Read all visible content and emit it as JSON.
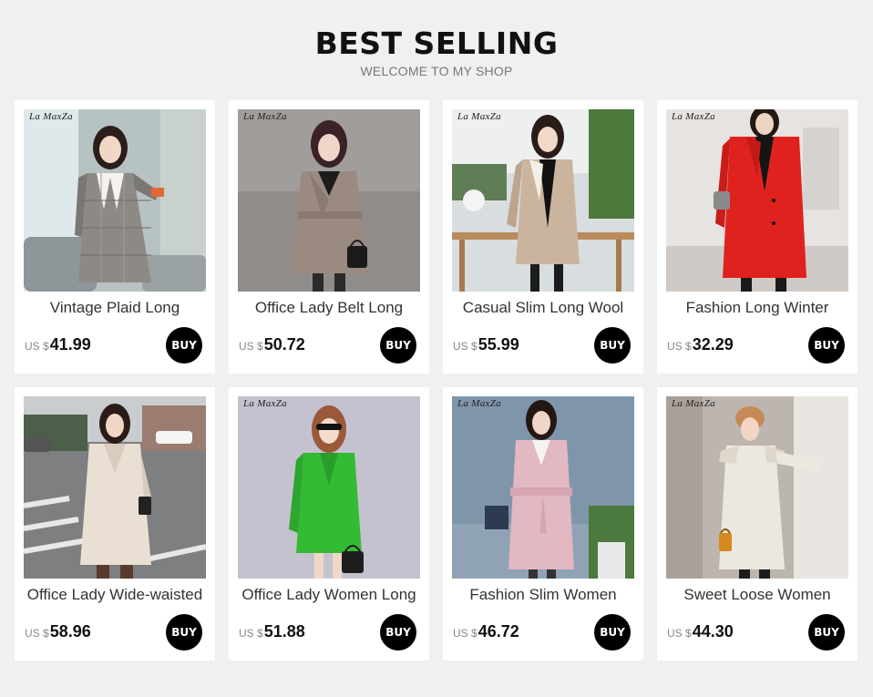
{
  "header": {
    "title": "BEST SELLING",
    "subtitle": "WELCOME TO MY SHOP"
  },
  "products": [
    {
      "name": "Vintage Plaid Long",
      "currency": "US $",
      "price": "41.99",
      "buy_label": "BUY",
      "brand": "La MaxZa",
      "image": "woman-in-gray-plaid-long-coat",
      "coat_color": "#8d8a86"
    },
    {
      "name": "Office Lady Belt Long",
      "currency": "US $",
      "price": "50.72",
      "buy_label": "BUY",
      "brand": "La MaxZa",
      "image": "woman-in-taupe-belted-coat",
      "coat_color": "#9a8a7f"
    },
    {
      "name": "Casual Slim Long Wool",
      "currency": "US $",
      "price": "55.99",
      "buy_label": "BUY",
      "brand": "La MaxZa",
      "image": "woman-in-beige-wool-coat",
      "coat_color": "#cbb49d"
    },
    {
      "name": "Fashion Long Winter",
      "currency": "US $",
      "price": "32.29",
      "buy_label": "BUY",
      "brand": "La MaxZa",
      "image": "woman-in-red-long-coat",
      "coat_color": "#e0221e"
    },
    {
      "name": "Office Lady Wide-waisted",
      "currency": "US $",
      "price": "58.96",
      "buy_label": "BUY",
      "brand": "",
      "image": "woman-in-cream-coat-on-street",
      "coat_color": "#eadfd3"
    },
    {
      "name": "Office Lady Women Long",
      "currency": "US $",
      "price": "51.88",
      "buy_label": "BUY",
      "brand": "La MaxZa",
      "image": "woman-in-green-coat",
      "coat_color": "#33bb33"
    },
    {
      "name": "Fashion Slim Women",
      "currency": "US $",
      "price": "46.72",
      "buy_label": "BUY",
      "brand": "La MaxZa",
      "image": "woman-in-pink-belted-coat",
      "coat_color": "#e2b8c2"
    },
    {
      "name": "Sweet Loose Women",
      "currency": "US $",
      "price": "44.30",
      "buy_label": "BUY",
      "brand": "La MaxZa",
      "image": "woman-in-white-ruffle-coat",
      "coat_color": "#ece8e0"
    }
  ]
}
